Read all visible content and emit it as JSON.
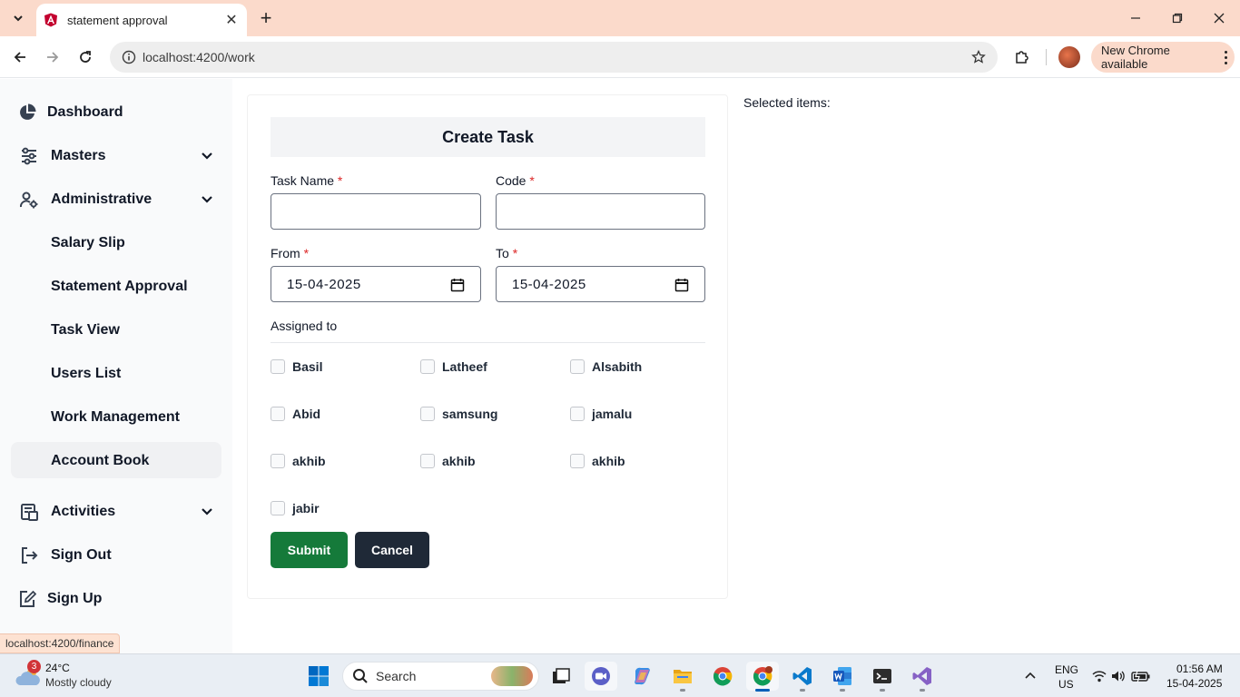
{
  "browser": {
    "tab_title": "statement approval",
    "url": "localhost:4200/work",
    "new_chrome_label": "New Chrome available",
    "status_url": "localhost:4200/finance"
  },
  "sidebar": {
    "items": [
      {
        "label": "Dashboard",
        "icon": "pie-chart-icon"
      },
      {
        "label": "Masters",
        "icon": "sliders-icon"
      },
      {
        "label": "Administrative",
        "icon": "user-gear-icon"
      },
      {
        "label": "Salary Slip"
      },
      {
        "label": "Statement Approval"
      },
      {
        "label": "Task View"
      },
      {
        "label": "Users List"
      },
      {
        "label": "Work Management"
      },
      {
        "label": "Account Book"
      },
      {
        "label": "Activities",
        "icon": "activities-icon"
      },
      {
        "label": "Sign Out",
        "icon": "sign-out-icon"
      },
      {
        "label": "Sign Up",
        "icon": "sign-up-icon"
      }
    ]
  },
  "form": {
    "title": "Create Task",
    "task_name_label": "Task Name",
    "code_label": "Code",
    "from_label": "From",
    "to_label": "To",
    "required_mark": "*",
    "from_value": "15-04-2025",
    "to_value": "15-04-2025",
    "assigned_label": "Assigned to",
    "assignees": [
      "Basil",
      "Latheef",
      "Alsabith",
      "Abid",
      "samsung",
      "jamalu",
      "akhib",
      "akhib",
      "akhib",
      "jabir"
    ],
    "submit_label": "Submit",
    "cancel_label": "Cancel"
  },
  "selected_items_label": "Selected items:",
  "taskbar": {
    "weather_badge": "3",
    "weather_temp": "24°C",
    "weather_desc": "Mostly cloudy",
    "search_label": "Search",
    "lang_1": "ENG",
    "lang_2": "US",
    "time": "01:56 AM",
    "date": "15-04-2025"
  }
}
